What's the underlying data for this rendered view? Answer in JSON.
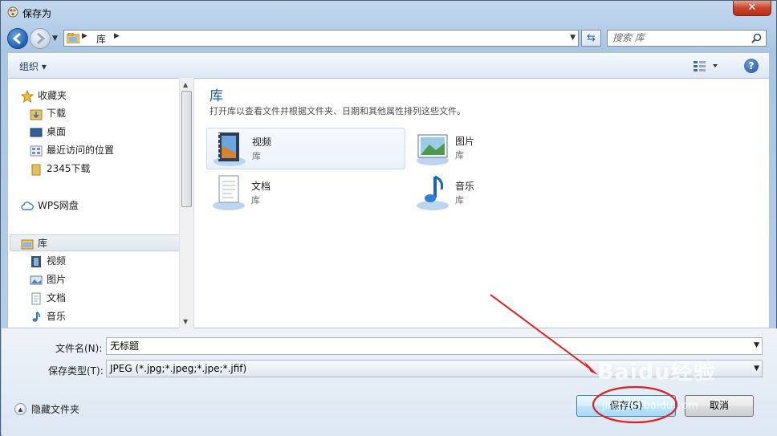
{
  "window": {
    "title": "保存为",
    "close_label": "✕"
  },
  "address": {
    "crumb": "库",
    "search_placeholder": "搜索 库"
  },
  "toolbar": {
    "organize_label": "组织 ▾",
    "help_label": "?"
  },
  "nav": {
    "favorites": {
      "label": "收藏夹",
      "items": [
        "下载",
        "桌面",
        "最近访问的位置",
        "2345下载"
      ]
    },
    "wps": {
      "label": "WPS网盘"
    },
    "libraries": {
      "label": "库",
      "items": [
        "视频",
        "图片",
        "文档",
        "音乐"
      ]
    }
  },
  "main": {
    "title": "库",
    "subtitle": "打开库以查看文件并根据文件夹、日期和其他属性排列这些文件。",
    "tiles": [
      {
        "name": "视频",
        "type": "库"
      },
      {
        "name": "图片",
        "type": "库"
      },
      {
        "name": "文档",
        "type": "库"
      },
      {
        "name": "音乐",
        "type": "库"
      }
    ]
  },
  "form": {
    "filename_label": "文件名(N):",
    "filename_value": "无标题",
    "filetype_label": "保存类型(T):",
    "filetype_value": "JPEG (*.jpg;*.jpeg;*.jpe;*.jfif)"
  },
  "footer": {
    "hide_folders_label": "隐藏文件夹",
    "save_label": "保存(S)",
    "cancel_label": "取消"
  },
  "watermark": {
    "text": "Baidu经验",
    "sub": "jingyan.baidu.com"
  },
  "colors": {
    "accent": "#1e5c9a",
    "annotation": "#e0201e"
  }
}
